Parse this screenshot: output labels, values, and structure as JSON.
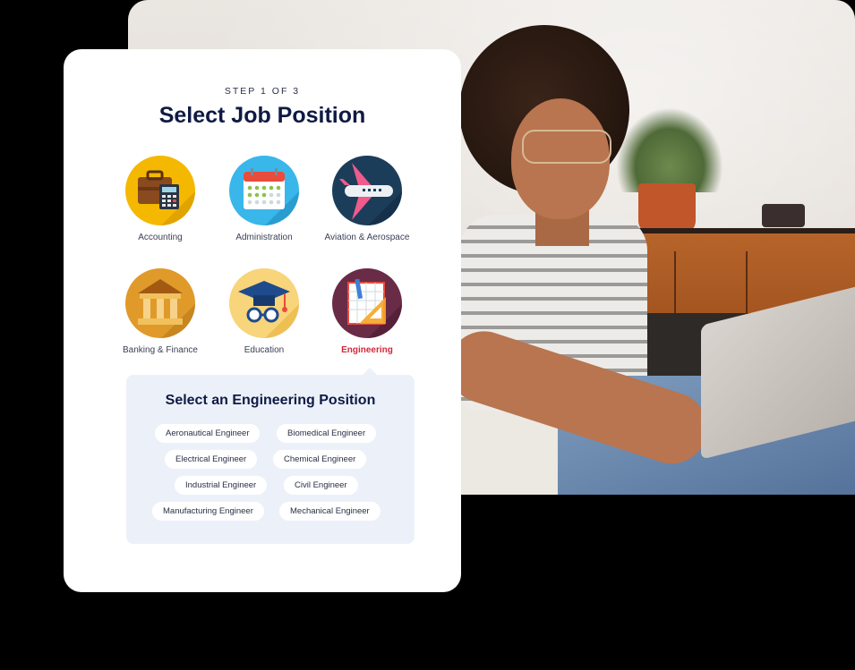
{
  "step": "STEP 1 OF 3",
  "title": "Select Job Position",
  "positions": [
    {
      "label": "Accounting",
      "icon": "briefcase-calculator-icon"
    },
    {
      "label": "Administration",
      "icon": "calendar-icon"
    },
    {
      "label": "Aviation & Aerospace",
      "icon": "airplane-icon"
    },
    {
      "label": "Banking & Finance",
      "icon": "bank-pillars-icon"
    },
    {
      "label": "Education",
      "icon": "graduation-cap-icon"
    },
    {
      "label": "Engineering",
      "icon": "blueprint-ruler-icon",
      "selected": true
    }
  ],
  "popup": {
    "title": "Select an Engineering Position",
    "chips": [
      "Aeronautical Engineer",
      "Biomedical Engineer",
      "Electrical Engineer",
      "Chemical Engineer",
      "Industrial Engineer",
      "Civil Engineer",
      "Manufacturing Engineer",
      "Mechanical Engineer"
    ]
  },
  "colors": {
    "accent": "#d2293b",
    "heading": "#0f1a44",
    "popup_bg": "#ecf1f9"
  }
}
